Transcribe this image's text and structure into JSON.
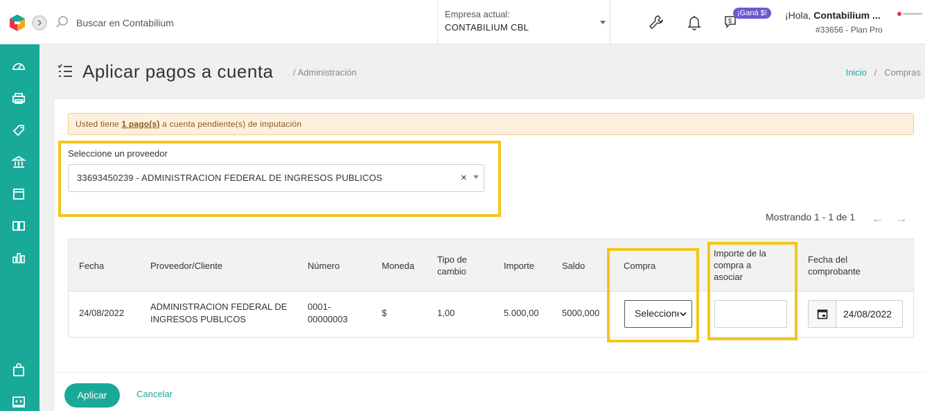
{
  "header": {
    "search_placeholder": "Buscar en Contabilium",
    "company_label": "Empresa actual:",
    "company_value": "CONTABILIUM CBL",
    "badge": "¡Ganá $!",
    "greeting_prefix": "¡Hola, ",
    "greeting_name": "Contabilium ...",
    "plan": "#33656 - Plan Pro"
  },
  "sidebar": {
    "items": [
      "dashboard-icon",
      "printer-icon",
      "tag-icon",
      "bank-icon",
      "box-icon",
      "book-icon",
      "bar-chart-icon",
      "bag-icon",
      "code-icon"
    ]
  },
  "page": {
    "title": "Aplicar pagos a cuenta",
    "section": "Administración",
    "breadcrumb_home": "Inicio",
    "breadcrumb_current": "Compras"
  },
  "alert": {
    "prefix": "Usted tiene ",
    "link": "1 pago(s)",
    "suffix": " a cuenta pendiente(s) de imputación"
  },
  "provider": {
    "label": "Seleccione un proveedor",
    "value": "33693450239 - ADMINISTRACION FEDERAL DE INGRESOS PUBLICOS",
    "clear": "×"
  },
  "pagination": {
    "text": "Mostrando 1 - 1 de 1",
    "prev": "←",
    "next": "→"
  },
  "table": {
    "headers": {
      "fecha": "Fecha",
      "proveedor": "Proveedor/Cliente",
      "numero": "Número",
      "moneda": "Moneda",
      "tipo_cambio_1": "Tipo de",
      "tipo_cambio_2": "cambio",
      "importe": "Importe",
      "saldo": "Saldo",
      "compra": "Compra",
      "importe_compra_1": "Importe de la",
      "importe_compra_2": "compra a",
      "importe_compra_3": "asociar",
      "fecha_comp_1": "Fecha del",
      "fecha_comp_2": "comprobante"
    },
    "row": {
      "fecha": "24/08/2022",
      "proveedor_1": "ADMINISTRACION FEDERAL DE",
      "proveedor_2": "INGRESOS PUBLICOS",
      "numero_1": "0001-",
      "numero_2": "00000003",
      "moneda": "$",
      "tipo_cambio": "1,00",
      "importe": "5.000,00",
      "saldo": "5000,000",
      "compra_select": "Seleccione",
      "importe_compra": "",
      "fecha_comprobante": "24/08/2022"
    }
  },
  "actions": {
    "apply": "Aplicar",
    "cancel": "Cancelar"
  },
  "colors": {
    "brand": "#18a999",
    "highlight": "#f5c518",
    "alert_bg": "#fdf0dc",
    "badge": "#6a5acd"
  }
}
